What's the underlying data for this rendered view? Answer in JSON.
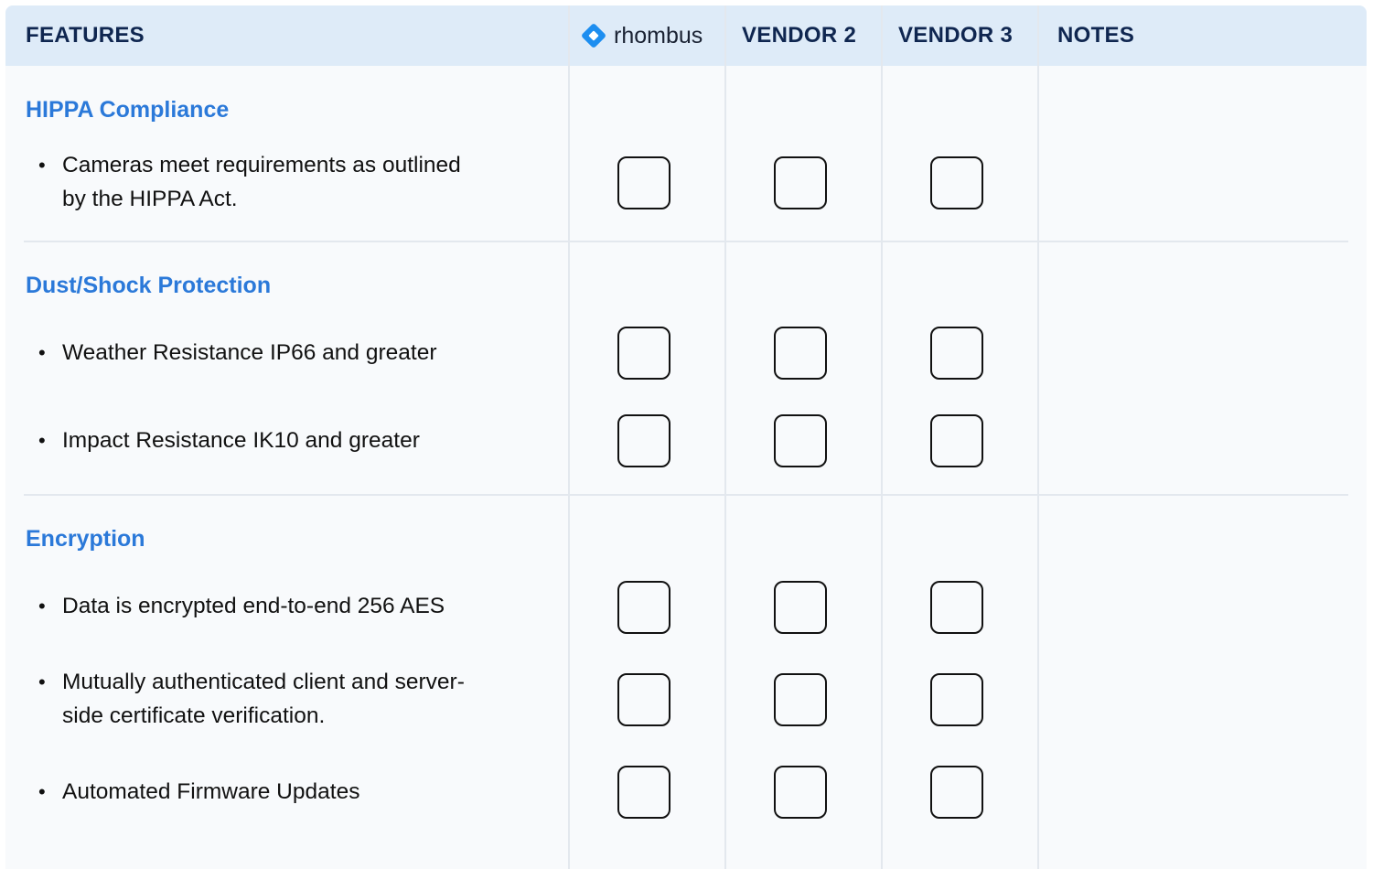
{
  "header": {
    "features": "FEATURES",
    "brand": "rhombus",
    "vendor2": "VENDOR 2",
    "vendor3": "VENDOR 3",
    "notes": "NOTES"
  },
  "colors": {
    "header_bg": "#deebf8",
    "header_text": "#0f2650",
    "section_title": "#2b79d9",
    "brand_logo": "#1d8ef0"
  },
  "sections": [
    {
      "title": "HIPPA Compliance",
      "items": [
        {
          "line1": "Cameras meet requirements as outlined",
          "line2": "by the HIPPA Act."
        }
      ]
    },
    {
      "title": "Dust/Shock Protection",
      "items": [
        {
          "line1": "Weather Resistance IP66 and greater"
        },
        {
          "line1": "Impact Resistance IK10 and greater"
        }
      ]
    },
    {
      "title": "Encryption",
      "items": [
        {
          "line1": "Data is encrypted end-to-end 256 AES"
        },
        {
          "line1": "Mutually authenticated client and server-",
          "line2": "side certificate verification."
        },
        {
          "line1": "Automated Firmware Updates"
        }
      ]
    }
  ],
  "bullet_char": "•"
}
